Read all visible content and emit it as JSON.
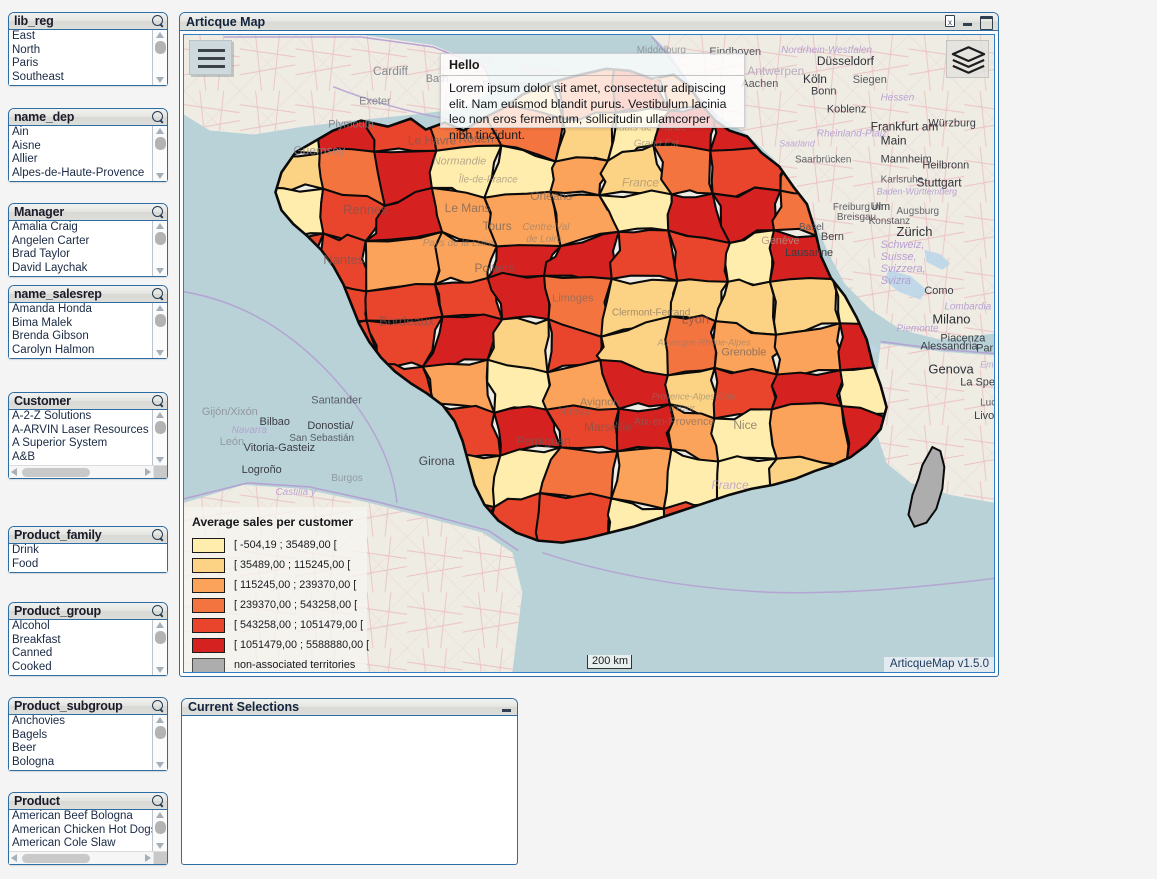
{
  "listboxes": [
    {
      "title": "lib_reg",
      "items": [
        "East",
        "North",
        "Paris",
        "Southeast"
      ],
      "vscroll": true,
      "hscroll": false
    },
    {
      "title": "name_dep",
      "items": [
        "Ain",
        "Aisne",
        "Allier",
        "Alpes-de-Haute-Provence"
      ],
      "vscroll": true,
      "hscroll": false
    },
    {
      "title": "Manager",
      "items": [
        "Amalia Craig",
        "Angelen Carter",
        "Brad Taylor",
        "David Laychak"
      ],
      "vscroll": true,
      "hscroll": false
    },
    {
      "title": "name_salesrep",
      "items": [
        "Amanda Honda",
        "Bima Malek",
        "Brenda Gibson",
        "Carolyn Halmon"
      ],
      "vscroll": true,
      "hscroll": false
    },
    {
      "title": "Customer",
      "items": [
        "A-2-Z Solutions",
        "A-ARVIN Laser Resources",
        "A Superior System",
        "A&B"
      ],
      "vscroll": true,
      "hscroll": true
    },
    {
      "title": "Product_family",
      "items": [
        "Drink",
        "Food"
      ],
      "vscroll": false,
      "hscroll": false
    },
    {
      "title": "Product_group",
      "items": [
        "Alcohol",
        "Breakfast",
        "Canned",
        "Cooked"
      ],
      "vscroll": true,
      "hscroll": false
    },
    {
      "title": "Product_subgroup",
      "items": [
        "Anchovies",
        "Bagels",
        "Beer",
        "Bologna"
      ],
      "vscroll": true,
      "hscroll": false
    },
    {
      "title": "Product",
      "items": [
        "American Beef Bologna",
        "American Chicken Hot Dogs",
        "American Cole Slaw"
      ],
      "vscroll": true,
      "hscroll": true
    }
  ],
  "map_panel": {
    "title": "Articque Map",
    "window_buttons": [
      {
        "name": "copy-to-clipboard-icon",
        "label": "Copy"
      },
      {
        "name": "minimize-icon",
        "label": "Minimize"
      },
      {
        "name": "maximize-icon",
        "label": "Maximize"
      }
    ],
    "menu_button": "menu-icon",
    "layers_button": "layers-icon",
    "scale_label": "200 km",
    "attribution": "ArticqueMap v1.5.0"
  },
  "tooltip": {
    "title": "Hello",
    "body": "Lorem ipsum dolor sit amet, consectetur adipiscing elit. Nam euismod blandit purus. Vestibulum lacinia leo non eros fermentum, sollicitudin ullamcorper nibh tincidunt."
  },
  "chart_data": {
    "type": "heatmap",
    "title": "Average sales per customer",
    "subtitle": "",
    "legend_position": "bottom-left",
    "classification": "manual intervals",
    "units": "sales value per customer",
    "geography": "France - departments",
    "classes": [
      {
        "label": "[ -504,19 ; 35489,00 [",
        "min": -504.19,
        "max": 35489.0,
        "color": "#ffedae"
      },
      {
        "label": "[ 35489,00 ; 115245,00 [",
        "min": 35489.0,
        "max": 115245.0,
        "color": "#fcd384"
      },
      {
        "label": "[ 115245,00 ; 239370,00 [",
        "min": 115245.0,
        "max": 239370.0,
        "color": "#fba35a"
      },
      {
        "label": "[ 239370,00 ; 543258,00 [",
        "min": 239370.0,
        "max": 543258.0,
        "color": "#f4743f"
      },
      {
        "label": "[ 543258,00 ; 1051479,00 [",
        "min": 543258.0,
        "max": 1051479.0,
        "color": "#e8452c"
      },
      {
        "label": "[ 1051479,00 ; 5588880,00 [",
        "min": 1051479.0,
        "max": 5588880.0,
        "color": "#d52221"
      }
    ],
    "no_data": {
      "label": "non-associated territories",
      "color": "#adadad"
    }
  },
  "current_selections": {
    "title": "Current Selections",
    "minimize_label": "Minimize",
    "items": []
  }
}
